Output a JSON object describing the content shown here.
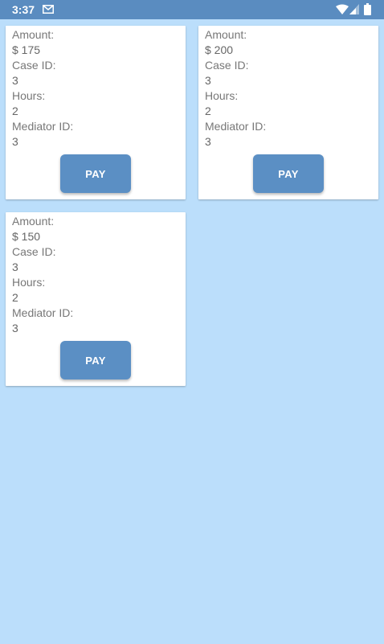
{
  "status_bar": {
    "time": "3:37",
    "icons": [
      "mail-icon",
      "wifi-icon",
      "signal-icon",
      "battery-icon"
    ]
  },
  "colors": {
    "background": "#bbdefb",
    "status_bar": "#5a8cc0",
    "button": "#5b8fc4",
    "card": "#ffffff"
  },
  "payments": [
    {
      "amount_label": "Amount:",
      "amount": "$ 175",
      "case_id_label": "Case ID:",
      "case_id": "3",
      "hours_label": "Hours:",
      "hours": "2",
      "mediator_id_label": "Mediator ID:",
      "mediator_id": "3",
      "button_label": "PAY"
    },
    {
      "amount_label": "Amount:",
      "amount": "$ 200",
      "case_id_label": "Case ID:",
      "case_id": "3",
      "hours_label": "Hours:",
      "hours": "2",
      "mediator_id_label": "Mediator ID:",
      "mediator_id": "3",
      "button_label": "PAY"
    },
    {
      "amount_label": "Amount:",
      "amount": "$ 150",
      "case_id_label": "Case ID:",
      "case_id": "3",
      "hours_label": "Hours:",
      "hours": "2",
      "mediator_id_label": "Mediator ID:",
      "mediator_id": "3",
      "button_label": "PAY"
    }
  ]
}
